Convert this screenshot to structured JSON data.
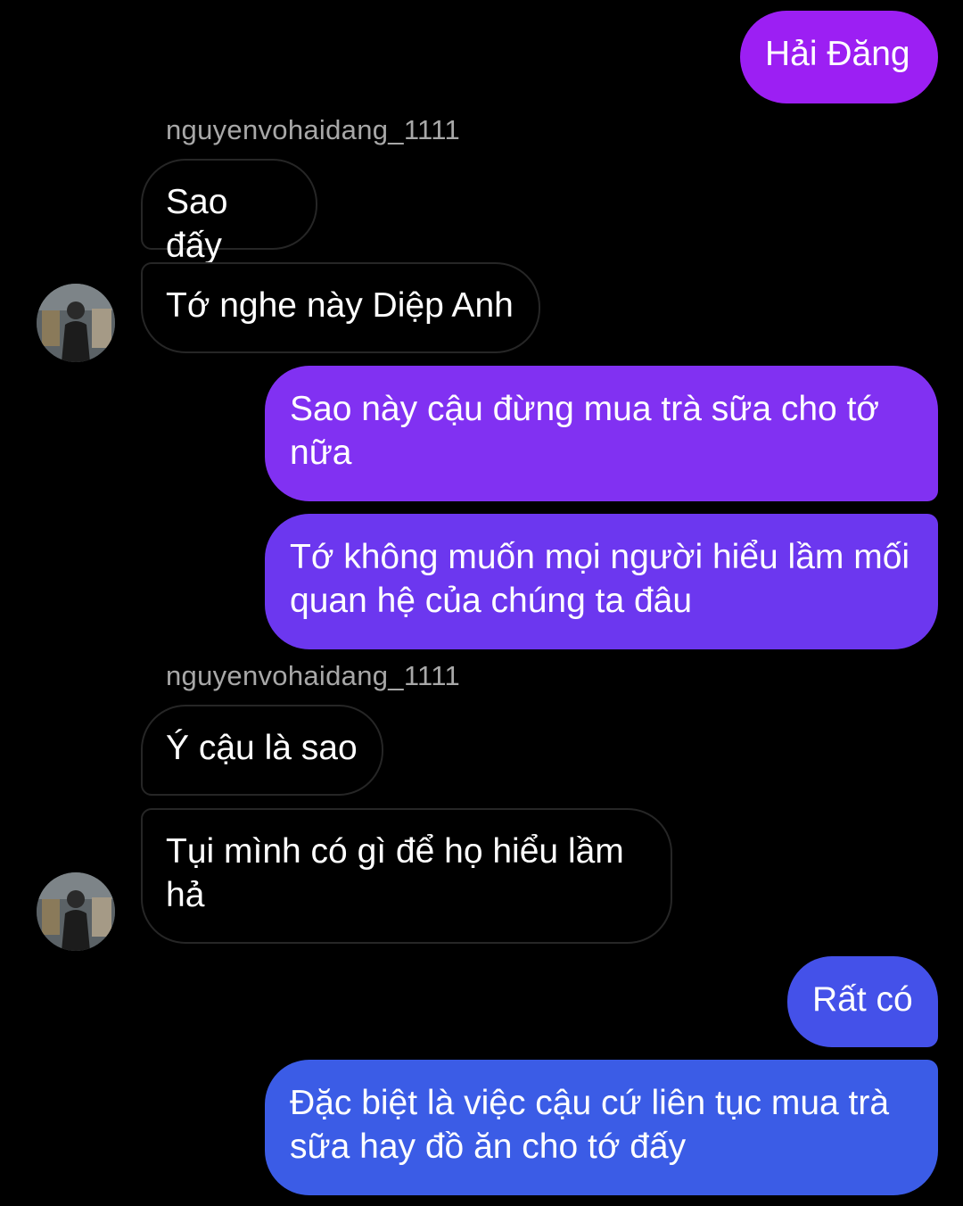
{
  "messages": [
    {
      "text": "Hải Đăng"
    },
    {
      "sender": "nguyenvohaidang_1111"
    },
    {
      "text": "Sao đấy"
    },
    {
      "text": "Tớ nghe này Diệp Anh"
    },
    {
      "text": "Sao này cậu đừng mua trà sữa cho tớ nữa"
    },
    {
      "text": "Tớ không muốn mọi người hiểu lầm mối quan hệ của chúng ta đâu"
    },
    {
      "sender": "nguyenvohaidang_1111"
    },
    {
      "text": "Ý cậu là sao"
    },
    {
      "text": "Tụi mình có gì để họ hiểu lầm hả"
    },
    {
      "text": "Rất có"
    },
    {
      "text": "Đặc biệt là việc cậu cứ liên tục mua trà sữa hay đồ ăn cho tớ đấy"
    }
  ],
  "colors": {
    "background": "#000000",
    "incoming_border": "#262626",
    "sender_text": "#a8a8a8",
    "outgoing_top": "#9b1ff2",
    "outgoing_mid": "#6b3ef0",
    "outgoing_bottom": "#3b5ce6"
  }
}
